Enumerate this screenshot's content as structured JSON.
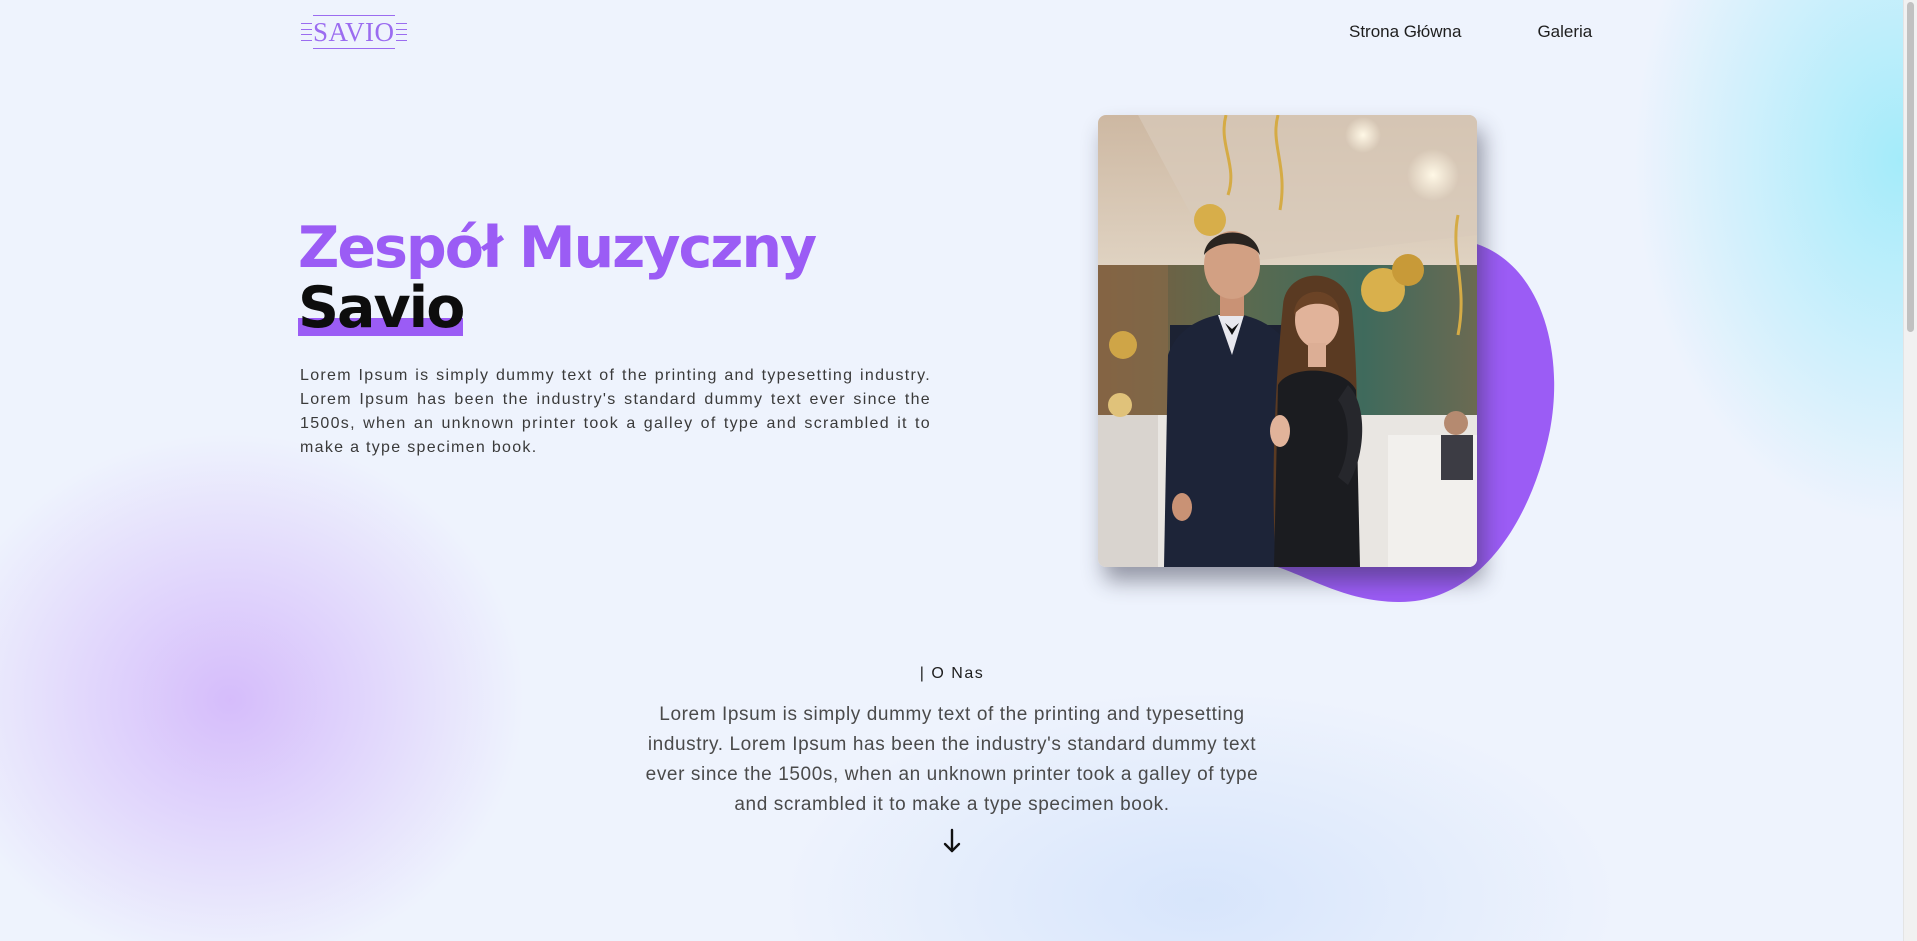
{
  "header": {
    "logo_text": "SAVIO",
    "nav": [
      {
        "label": "Strona Główna"
      },
      {
        "label": "Galeria"
      }
    ]
  },
  "hero": {
    "title_line1": "Zespół Muzyczny",
    "title_line2": "Savio",
    "description": "Lorem Ipsum is simply dummy text of the printing and typesetting industry. Lorem Ipsum has been the industry's standard dummy text ever since the 1500s, when an unknown printer took a galley of type and scrambled it to make a type specimen book."
  },
  "about": {
    "heading": "| O Nas",
    "text": "Lorem Ipsum is simply dummy text of the printing and typesetting industry. Lorem Ipsum has been the industry's standard dummy text ever since the 1500s, when an unknown printer took a galley of type and scrambled it to make a type specimen book.",
    "scroll_icon": "arrow-down-icon"
  },
  "colors": {
    "accent": "#9b5cf5",
    "logo": "#9b6cf0",
    "background": "#eef3fd"
  }
}
